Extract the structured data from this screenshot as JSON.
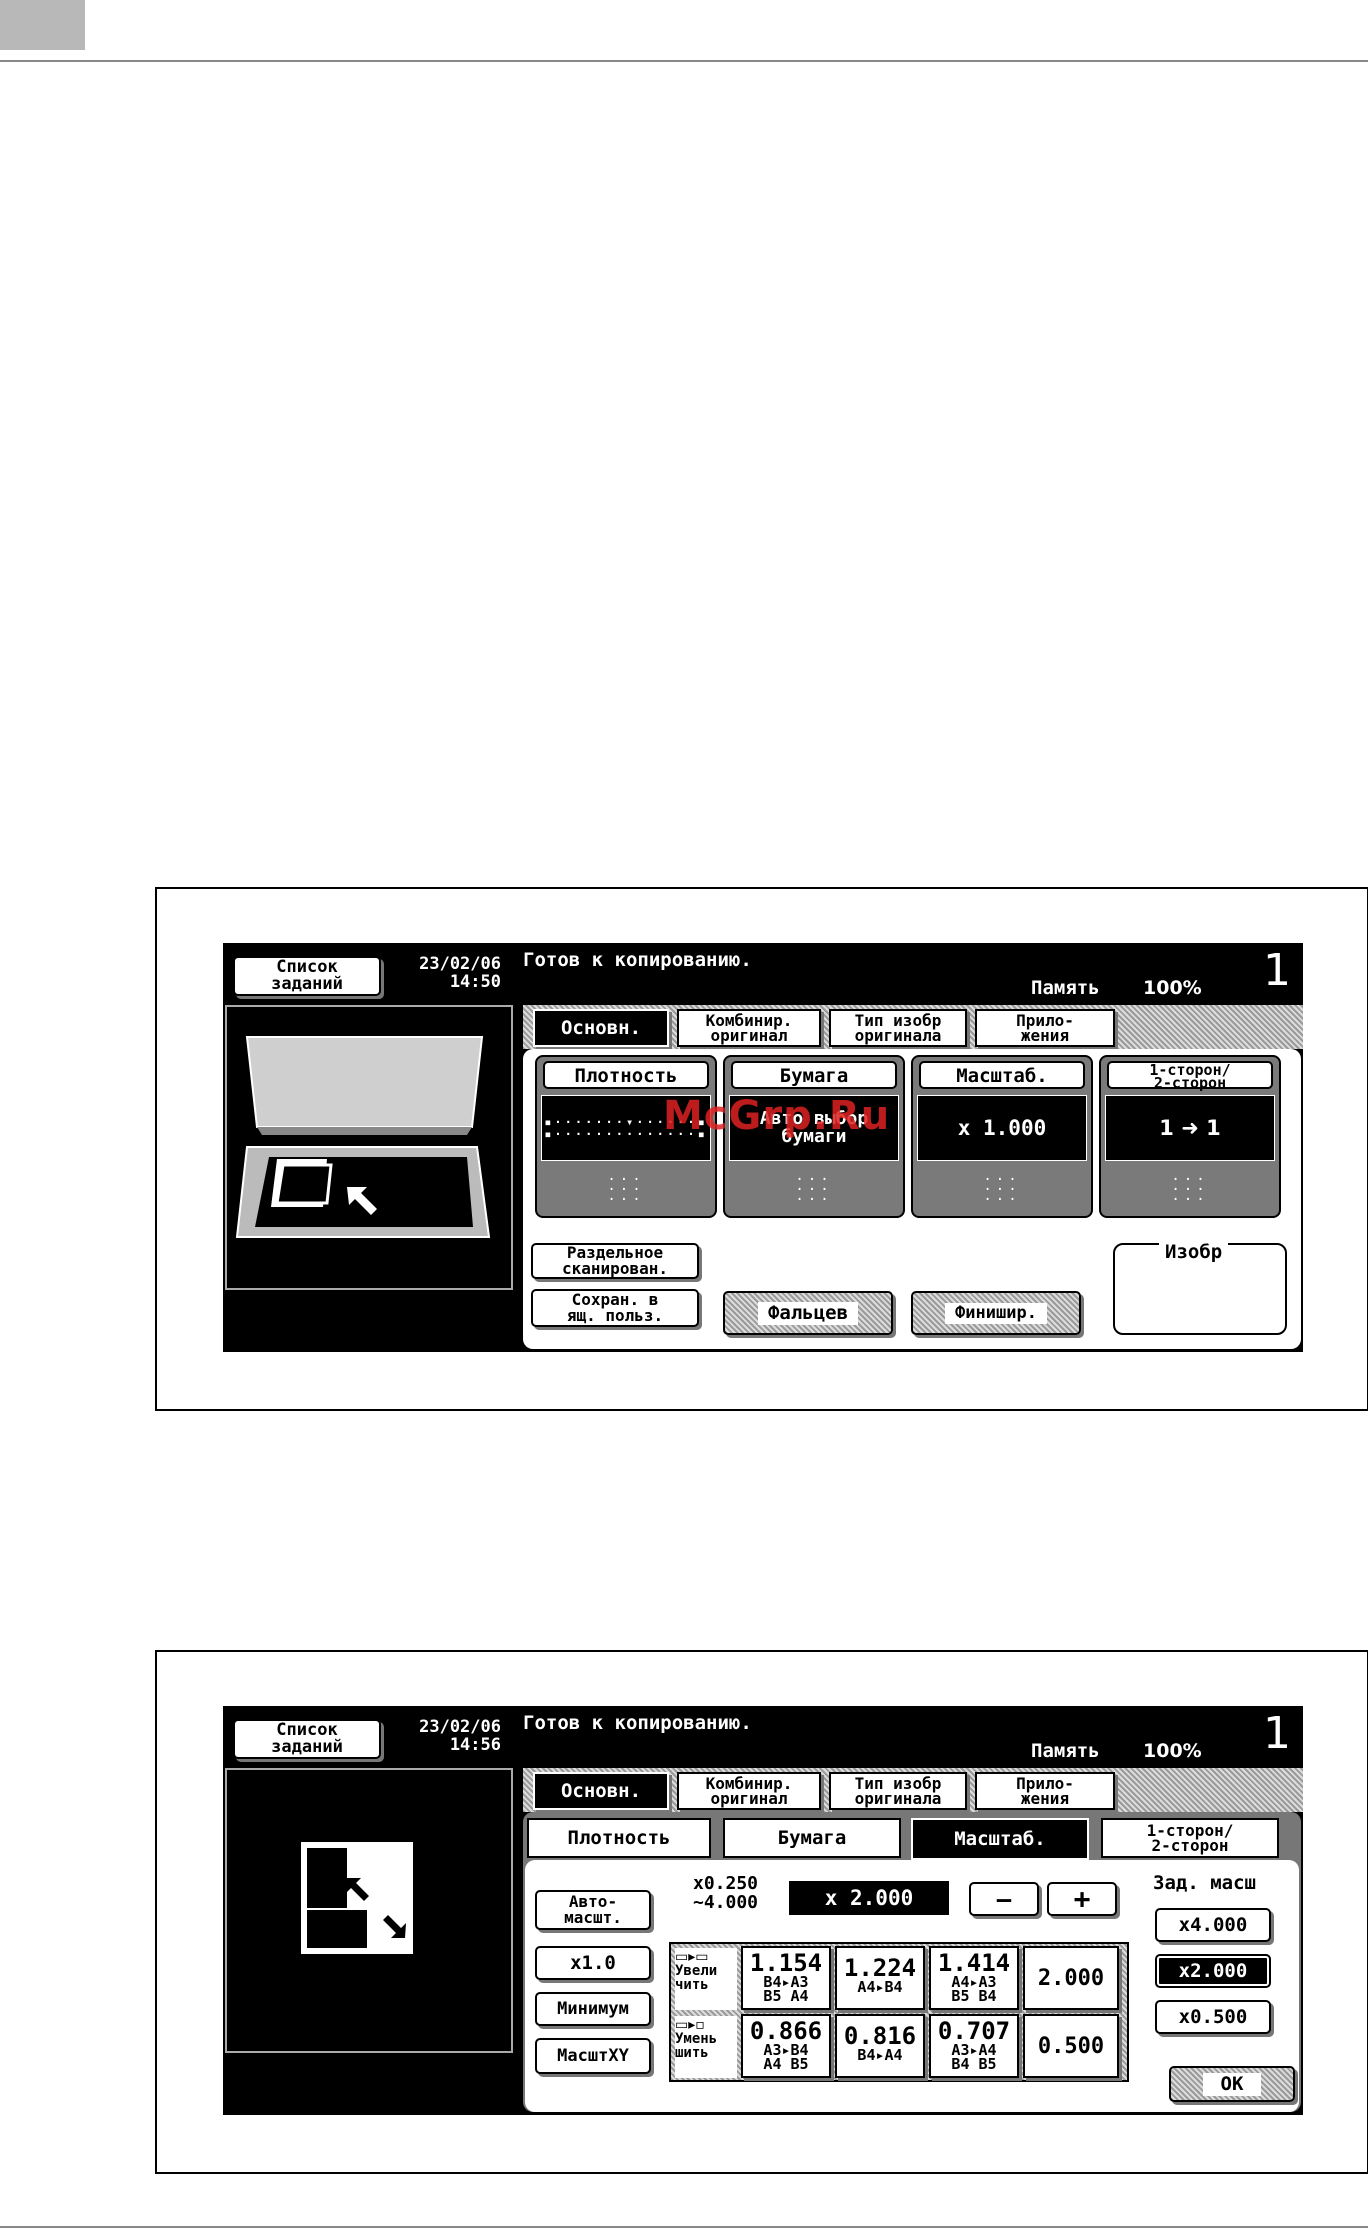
{
  "screen1": {
    "header": {
      "job_list_label_1": "Список",
      "job_list_label_2": "заданий",
      "date": "23/02/06",
      "time": "14:50",
      "status": "Готов к копированию.",
      "memory_label": "Память",
      "memory_value": "100%",
      "copies": "1"
    },
    "tabs": [
      {
        "label": "Основн."
      },
      {
        "label1": "Комбинир.",
        "label2": "оригинал"
      },
      {
        "label1": "Тип изобр",
        "label2": "оригинала"
      },
      {
        "label1": "Прило-",
        "label2": "жения"
      }
    ],
    "cards": {
      "density": {
        "label": "Плотность"
      },
      "paper": {
        "label": "Бумага",
        "value1": "Авто выбор",
        "value2": "бумаги"
      },
      "zoom": {
        "label": "Масштаб.",
        "value": "x 1.000"
      },
      "duplex": {
        "label1": "1-сторон/",
        "label2": "2-сторон",
        "value": "1 ➜ 1"
      }
    },
    "separate_scan_1": "Раздельное",
    "separate_scan_2": "сканирован.",
    "save_box_1": "Сохран. в",
    "save_box_2": "ящ. польз.",
    "fold_label": "Фальцев",
    "finish_label": "Финишир.",
    "image_label": "Изобр",
    "watermark": "McGrp.Ru"
  },
  "screen2": {
    "header": {
      "job_list_label_1": "Список",
      "job_list_label_2": "заданий",
      "date": "23/02/06",
      "time": "14:56",
      "status": "Готов к копированию.",
      "memory_label": "Память",
      "memory_value": "100%",
      "copies": "1"
    },
    "tabs": [
      {
        "label": "Основн."
      },
      {
        "label1": "Комбинир.",
        "label2": "оригинал"
      },
      {
        "label1": "Тип изобр",
        "label2": "оригинала"
      },
      {
        "label1": "Прило-",
        "label2": "жения"
      }
    ],
    "subtabs": [
      {
        "label": "Плотность"
      },
      {
        "label": "Бумага"
      },
      {
        "label": "Масштаб."
      },
      {
        "label1": "1-сторон/",
        "label2": "2-сторон"
      }
    ],
    "range_1": "x0.250",
    "range_2": "~4.000",
    "current_zoom": "x 2.000",
    "minus": "—",
    "plus": "+",
    "preset_title": "Зад. масш",
    "presets": [
      "x4.000",
      "x2.000",
      "x0.500"
    ],
    "ok": "OK",
    "auto_1": "Авто-",
    "auto_2": "масшт.",
    "x1": "x1.0",
    "minimum": "Минимум",
    "xy": "МасштXY",
    "enlarge_1": "Увели",
    "enlarge_2": "чить",
    "reduce_1": "Умень",
    "reduce_2": "шить",
    "enlarge": [
      {
        "value": "1.154",
        "sub1": "B4▸A3",
        "sub2": "B5  A4"
      },
      {
        "value": "1.224",
        "sub1": "A4▸B4",
        "sub2": ""
      },
      {
        "value": "1.414",
        "sub1": "A4▸A3",
        "sub2": "B5  B4"
      },
      {
        "value": "2.000",
        "sub1": "",
        "sub2": ""
      }
    ],
    "reduce": [
      {
        "value": "0.866",
        "sub1": "A3▸B4",
        "sub2": "A4  B5"
      },
      {
        "value": "0.816",
        "sub1": "B4▸A4",
        "sub2": ""
      },
      {
        "value": "0.707",
        "sub1": "A3▸A4",
        "sub2": "B4  B5"
      },
      {
        "value": "0.500",
        "sub1": "",
        "sub2": ""
      }
    ]
  }
}
